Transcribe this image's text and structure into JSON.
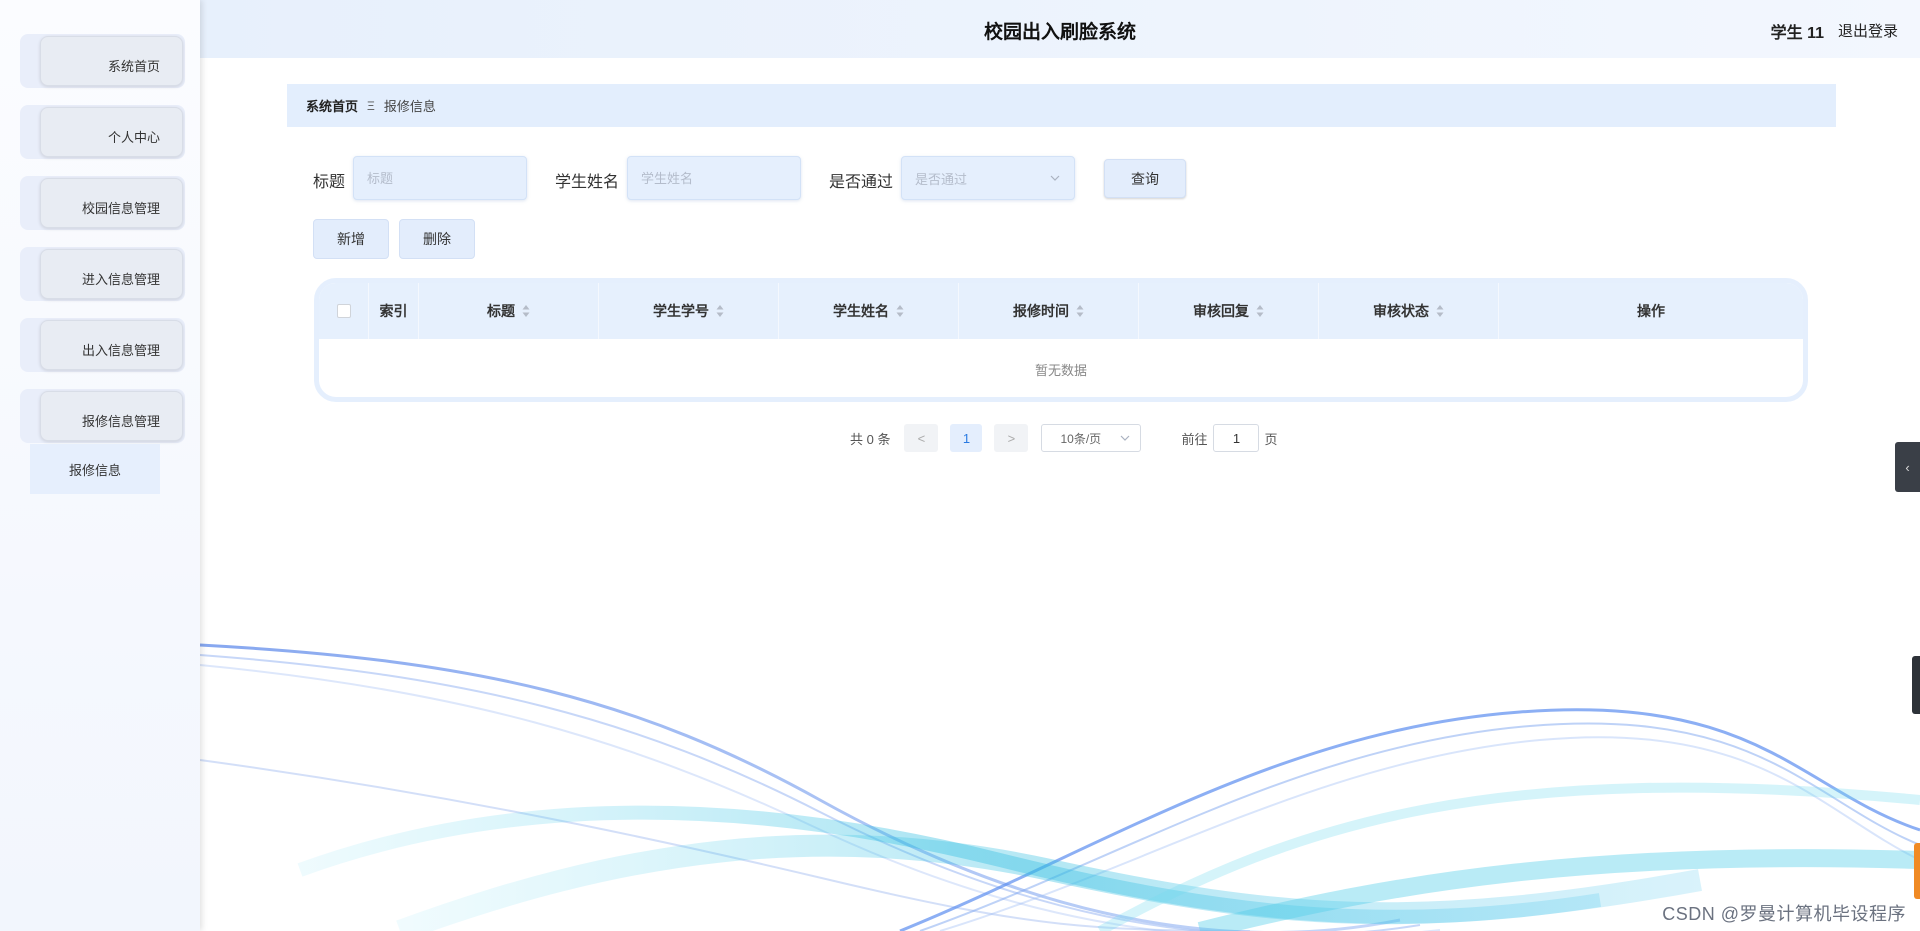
{
  "header": {
    "title": "校园出入刷脸系统",
    "user": "学生 11",
    "logout": "退出登录"
  },
  "sidebar": {
    "items": [
      {
        "label": "系统首页"
      },
      {
        "label": "个人中心"
      },
      {
        "label": "校园信息管理"
      },
      {
        "label": "进入信息管理"
      },
      {
        "label": "出入信息管理"
      },
      {
        "label": "报修信息管理"
      }
    ],
    "submenu_active": "报修信息"
  },
  "breadcrumb": {
    "home": "系统首页",
    "separator": "Ξ",
    "current": "报修信息"
  },
  "search": {
    "title_label": "标题",
    "title_placeholder": "标题",
    "student_label": "学生姓名",
    "student_placeholder": "学生姓名",
    "passed_label": "是否通过",
    "passed_placeholder": "是否通过",
    "query_button": "查询"
  },
  "actions": {
    "add": "新增",
    "delete": "删除"
  },
  "table": {
    "columns": [
      "索引",
      "标题",
      "学生学号",
      "学生姓名",
      "报修时间",
      "审核回复",
      "审核状态",
      "操作"
    ],
    "empty_text": "暂无数据"
  },
  "pagination": {
    "total": "共 0 条",
    "prev": "<",
    "current_page": "1",
    "next": ">",
    "page_size": "10条/页",
    "goto_label": "前往",
    "goto_value": "1",
    "page_suffix": "页"
  },
  "overlay": {
    "collapse_glyph": "‹",
    "watermark": "CSDN @罗曼计算机毕设程序"
  },
  "colors": {
    "accent": "#2a7ae2",
    "panel": "#e3eefd",
    "wave_blue": "#5b8def",
    "wave_cyan": "#35c6e6"
  }
}
